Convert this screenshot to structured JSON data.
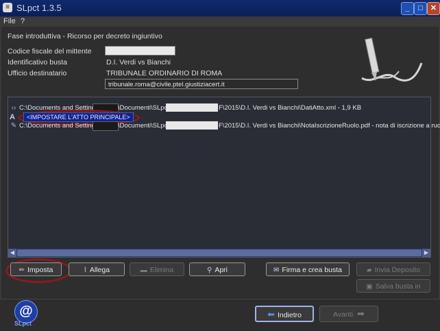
{
  "window": {
    "title": "SLpct 1.3.5",
    "min_label": "_",
    "max_label": "□",
    "close_label": "✕"
  },
  "menu": {
    "file": "File",
    "help": "?"
  },
  "header": {
    "phase": "Fase introduttiva - Ricorso per decreto ingiuntivo",
    "codice_label": "Codice fiscale del mittente",
    "busta_label": "Identificativo busta",
    "busta_value": "D.I. Verdi vs Bianchi",
    "ufficio_label": "Ufficio destinatario",
    "ufficio_value": "TRIBUNALE ORDINARIO DI ROMA",
    "pec": "tribunale.roma@civile.ptel.giustiziacert.it"
  },
  "files": {
    "row1_prefix": "C:\\Documents and Settings\\",
    "row1_mid": "\\Documenti\\SLpct\\",
    "row1_suffix": "F\\2015\\D.I. Verdi vs Bianchi\\DatiAtto.xml - 1,9 KB",
    "row2_label": "<IMPOSTARE L'ATTO PRINCIPALE>",
    "row3_prefix": "C:\\Documents and Settings\\",
    "row3_mid": "\\Documenti\\SLpct\\",
    "row3_suffix": "F\\2015\\D.I. Verdi vs Bianchi\\NotaIscrizioneRuolo.pdf - nota di iscrizione a ruolo -"
  },
  "buttons": {
    "imposta": "Imposta",
    "allega": "Allega",
    "elimina": "Elimina",
    "apri": "Apri",
    "firma": "Firma e crea busta",
    "invia": "Invia Deposito",
    "salva": "Salva busta in",
    "indietro": "Indietro",
    "avanti": "Avanti"
  },
  "footer": {
    "logo_caption": "SLpct",
    "logo_glyph": "@"
  }
}
